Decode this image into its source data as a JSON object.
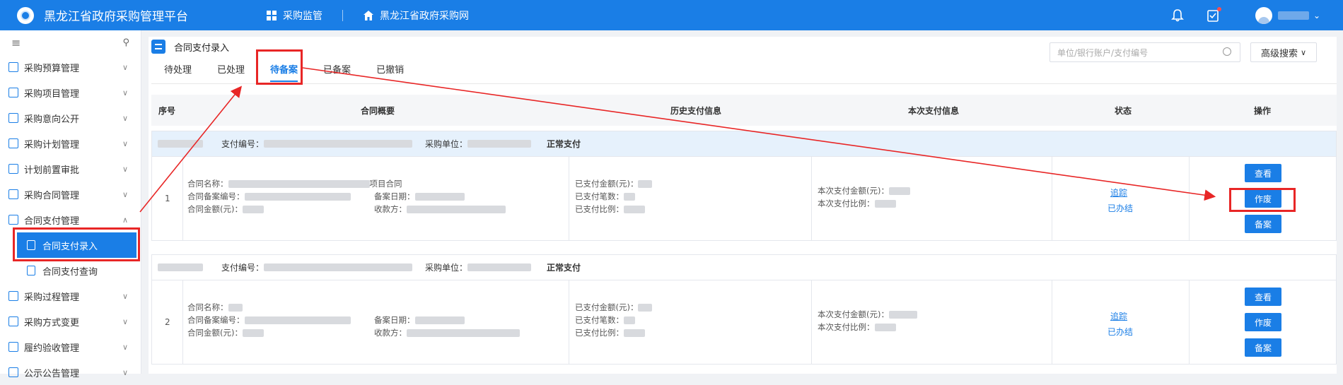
{
  "header": {
    "title": "黑龙江省政府采购管理平台",
    "nav": [
      "采购监管",
      "黑龙江省政府采购网"
    ]
  },
  "sidebar": {
    "items": [
      {
        "label": "采购预算管理",
        "chev": "∨"
      },
      {
        "label": "采购项目管理",
        "chev": "∨"
      },
      {
        "label": "采购意向公开",
        "chev": "∨"
      },
      {
        "label": "采购计划管理",
        "chev": "∨"
      },
      {
        "label": "计划前置审批",
        "chev": "∨"
      },
      {
        "label": "采购合同管理",
        "chev": "∨"
      },
      {
        "label": "合同支付管理",
        "chev": "∧"
      }
    ],
    "subitems": [
      "合同支付录入",
      "合同支付查询"
    ],
    "items_after": [
      {
        "label": "采购过程管理",
        "chev": "∨"
      },
      {
        "label": "采购方式变更",
        "chev": "∨"
      },
      {
        "label": "履约验收管理",
        "chev": "∨"
      },
      {
        "label": "公示公告管理",
        "chev": "∨"
      }
    ]
  },
  "page": {
    "title": "合同支付录入",
    "tabs": [
      "待处理",
      "已处理",
      "待备案",
      "已备案",
      "已撤销"
    ],
    "search_placeholder": "单位/银行账户/支付编号",
    "advanced_search": "高级搜索"
  },
  "table": {
    "headers": [
      "序号",
      "合同概要",
      "历史支付信息",
      "本次支付信息",
      "状态",
      "操作"
    ],
    "head_labels": {
      "pay_no": "支付编号：",
      "unit": "采购单位：",
      "pay_type": "正常支付"
    },
    "row_labels": {
      "name": "合同名称：",
      "record_no": "合同备案编号：",
      "amount": "合同金额(元)：",
      "record_date": "备案日期：",
      "payee": "收款方：",
      "paid_amount": "已支付金额(元)：",
      "paid_count": "已支付笔数：",
      "paid_ratio": "已支付比例：",
      "cur_amount": "本次支付金额(元)：",
      "cur_ratio": "本次支付比例："
    },
    "rows": [
      {
        "seq": "1",
        "name_suffix": "项目合同",
        "status_link": "追踪",
        "status_text": "已办结",
        "actions": [
          "查看",
          "作废",
          "备案"
        ]
      },
      {
        "seq": "2",
        "status_link": "追踪",
        "status_text": "已办结",
        "actions": [
          "查看",
          "作废",
          "备案"
        ]
      }
    ]
  },
  "colors": {
    "primary": "#1a7ee6",
    "highlight": "#e82626"
  }
}
